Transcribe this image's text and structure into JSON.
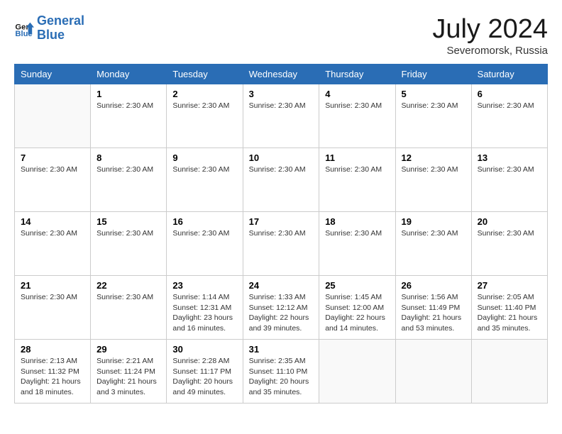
{
  "header": {
    "logo_line1": "General",
    "logo_line2": "Blue",
    "month": "July 2024",
    "location": "Severomorsk, Russia"
  },
  "weekdays": [
    "Sunday",
    "Monday",
    "Tuesday",
    "Wednesday",
    "Thursday",
    "Friday",
    "Saturday"
  ],
  "weeks": [
    [
      {
        "day": "",
        "info": ""
      },
      {
        "day": "1",
        "info": "Sunrise: 2:30 AM"
      },
      {
        "day": "2",
        "info": "Sunrise: 2:30 AM"
      },
      {
        "day": "3",
        "info": "Sunrise: 2:30 AM"
      },
      {
        "day": "4",
        "info": "Sunrise: 2:30 AM"
      },
      {
        "day": "5",
        "info": "Sunrise: 2:30 AM"
      },
      {
        "day": "6",
        "info": "Sunrise: 2:30 AM"
      }
    ],
    [
      {
        "day": "7",
        "info": "Sunrise: 2:30 AM"
      },
      {
        "day": "8",
        "info": "Sunrise: 2:30 AM"
      },
      {
        "day": "9",
        "info": "Sunrise: 2:30 AM"
      },
      {
        "day": "10",
        "info": "Sunrise: 2:30 AM"
      },
      {
        "day": "11",
        "info": "Sunrise: 2:30 AM"
      },
      {
        "day": "12",
        "info": "Sunrise: 2:30 AM"
      },
      {
        "day": "13",
        "info": "Sunrise: 2:30 AM"
      }
    ],
    [
      {
        "day": "14",
        "info": "Sunrise: 2:30 AM"
      },
      {
        "day": "15",
        "info": "Sunrise: 2:30 AM"
      },
      {
        "day": "16",
        "info": "Sunrise: 2:30 AM"
      },
      {
        "day": "17",
        "info": "Sunrise: 2:30 AM"
      },
      {
        "day": "18",
        "info": "Sunrise: 2:30 AM"
      },
      {
        "day": "19",
        "info": "Sunrise: 2:30 AM"
      },
      {
        "day": "20",
        "info": "Sunrise: 2:30 AM"
      }
    ],
    [
      {
        "day": "21",
        "info": "Sunrise: 2:30 AM"
      },
      {
        "day": "22",
        "info": "Sunrise: 2:30 AM"
      },
      {
        "day": "23",
        "info": "Sunrise: 1:14 AM\nSunset: 12:31 AM\nDaylight: 23 hours and 16 minutes."
      },
      {
        "day": "24",
        "info": "Sunrise: 1:33 AM\nSunset: 12:12 AM\nDaylight: 22 hours and 39 minutes."
      },
      {
        "day": "25",
        "info": "Sunrise: 1:45 AM\nSunset: 12:00 AM\nDaylight: 22 hours and 14 minutes."
      },
      {
        "day": "26",
        "info": "Sunrise: 1:56 AM\nSunset: 11:49 PM\nDaylight: 21 hours and 53 minutes."
      },
      {
        "day": "27",
        "info": "Sunrise: 2:05 AM\nSunset: 11:40 PM\nDaylight: 21 hours and 35 minutes."
      }
    ],
    [
      {
        "day": "28",
        "info": "Sunrise: 2:13 AM\nSunset: 11:32 PM\nDaylight: 21 hours and 18 minutes."
      },
      {
        "day": "29",
        "info": "Sunrise: 2:21 AM\nSunset: 11:24 PM\nDaylight: 21 hours and 3 minutes."
      },
      {
        "day": "30",
        "info": "Sunrise: 2:28 AM\nSunset: 11:17 PM\nDaylight: 20 hours and 49 minutes."
      },
      {
        "day": "31",
        "info": "Sunrise: 2:35 AM\nSunset: 11:10 PM\nDaylight: 20 hours and 35 minutes."
      },
      {
        "day": "",
        "info": ""
      },
      {
        "day": "",
        "info": ""
      },
      {
        "day": "",
        "info": ""
      }
    ]
  ]
}
